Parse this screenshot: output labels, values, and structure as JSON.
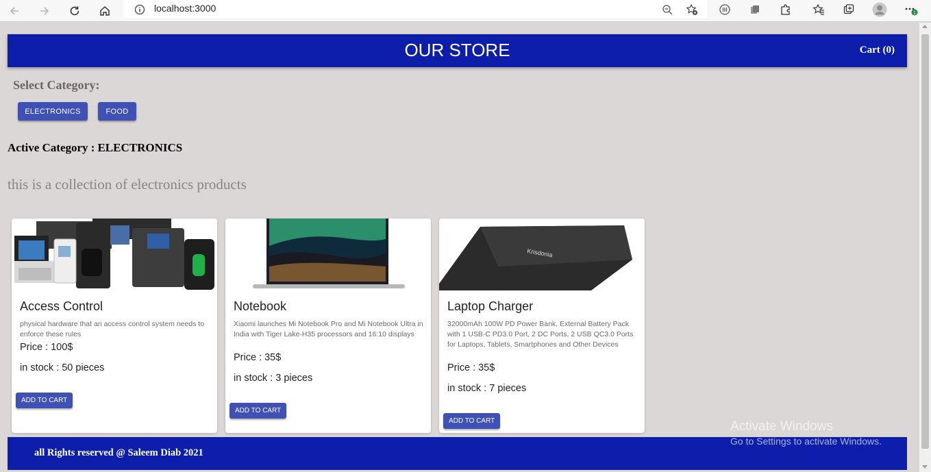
{
  "browser": {
    "url": "localhost:3000",
    "profile_badge": "1"
  },
  "header": {
    "title": "OUR STORE",
    "cart_label": "Cart (0)"
  },
  "categories": {
    "label": "Select Category:",
    "buttons": [
      "ELECTRONICS",
      "FOOD"
    ],
    "active_prefix": "Active Category :",
    "active_value": "ELECTRONICS",
    "description": "this is a collection of electronics products"
  },
  "products": [
    {
      "name": "Access Control",
      "description": "physical hardware that an access control system needs to enforce these rules",
      "price": "Price : 100$",
      "stock": "in stock : 50 pieces",
      "button": "ADD TO CART"
    },
    {
      "name": "Notebook",
      "description": "Xiaomi launches Mi Notebook Pro and Mi Notebook Ultra in India with Tiger Lake-H35 processors and 16:10 displays",
      "price": "Price : 35$",
      "stock": "in stock : 3 pieces",
      "button": "ADD TO CART"
    },
    {
      "name": "Laptop Charger",
      "description": "32000mAh 100W PD Power Bank, External Battery Pack with 1 USB-C PD3.0 Port, 2 DC Ports, 2 USB QC3.0 Ports for Laptops, Tablets, Smartphones and Other Devices",
      "price": "Price : 35$",
      "stock": "in stock : 7 pieces",
      "button": "ADD TO CART"
    }
  ],
  "charger_brand": "Krisdonia",
  "footer": {
    "text": "all Rights reserved @ Saleem Diab 2021"
  },
  "watermark": {
    "line1": "Activate Windows",
    "line2": "Go to Settings to activate Windows."
  },
  "colors": {
    "brand_blue": "#0c1eaa",
    "button_indigo": "#3f51b5",
    "page_bg": "#dbd7d6"
  }
}
